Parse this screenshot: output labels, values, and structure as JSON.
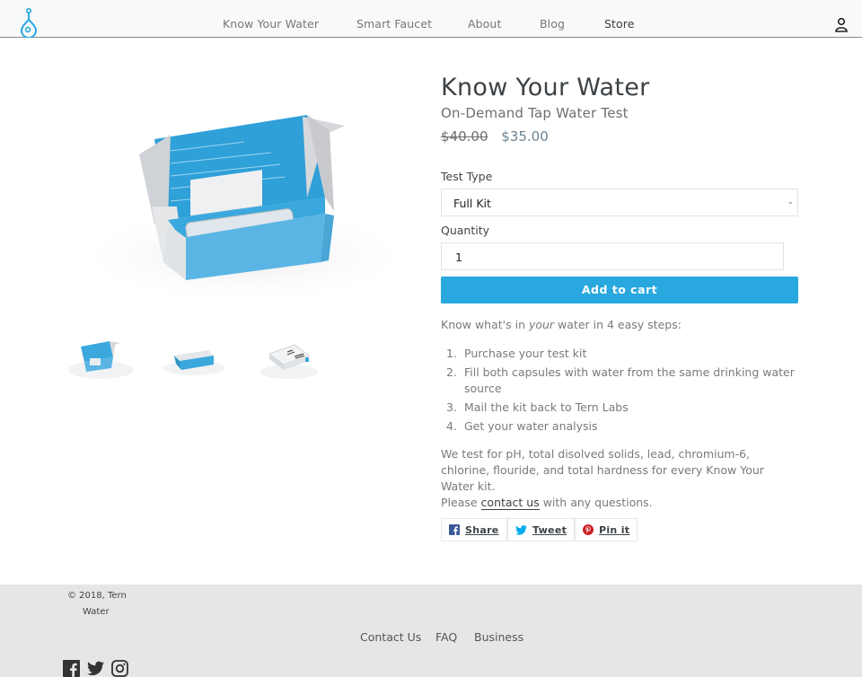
{
  "header": {
    "logo_alt": "Tern Water logo",
    "nav": [
      {
        "label": "Know Your Water",
        "active": false
      },
      {
        "label": "Smart Faucet",
        "active": false
      },
      {
        "label": "About",
        "active": false
      },
      {
        "label": "Blog",
        "active": false
      },
      {
        "label": "Store",
        "active": true
      }
    ],
    "account_icon": "user-icon"
  },
  "gallery": {
    "main_image": "Open blue test kit box with two water capsules",
    "thumbnails": [
      {
        "alt": "Open test kit box"
      },
      {
        "alt": "Closed test kit box"
      },
      {
        "alt": "Test kit box with shipping label"
      }
    ]
  },
  "product": {
    "title": "Know Your Water",
    "subtitle": "On-Demand Tap Water Test",
    "price_original": "$40.00",
    "price_sale": "$35.00",
    "test_type_label": "Test Type",
    "test_type_value": "Full Kit",
    "quantity_label": "Quantity",
    "quantity_value": "1",
    "add_to_cart": "Add to cart",
    "intro_before": "Know what's in ",
    "intro_em": "your",
    "intro_after": " water in 4 easy steps:",
    "steps": [
      {
        "num": "1.",
        "text": "Purchase your test kit"
      },
      {
        "num": "2.",
        "text": "Fill both capsules with water from the same drinking water source"
      },
      {
        "num": "3.",
        "text": "Mail the kit back to Tern Labs"
      },
      {
        "num": "4.",
        "text": "Get your water analysis"
      }
    ],
    "tests_text": "We test for pH, total disolved solids, lead, chromium-6, chlorine, flouride, and total hardness for every Know Your Water kit.",
    "please_text": "Please ",
    "contact_link": "contact us",
    "questions_text": " with any questions."
  },
  "share": [
    {
      "label": "Share",
      "icon": "facebook-icon",
      "color": "#3b5998"
    },
    {
      "label": "Tweet",
      "icon": "twitter-icon",
      "color": "#00aced"
    },
    {
      "label": "Pin it",
      "icon": "pinterest-icon",
      "color": "#cb2027"
    }
  ],
  "footer": {
    "copyright_line1": "© 2018, Tern",
    "copyright_line2": "Water",
    "links": [
      "Contact Us",
      "FAQ",
      "Business"
    ],
    "social": [
      "facebook-icon",
      "twitter-icon",
      "instagram-icon"
    ]
  },
  "colors": {
    "accent": "#29a8e0",
    "logo": "#29a8e0",
    "footer_bg": "#e6e6e6",
    "header_bg": "#f8f9fa"
  }
}
